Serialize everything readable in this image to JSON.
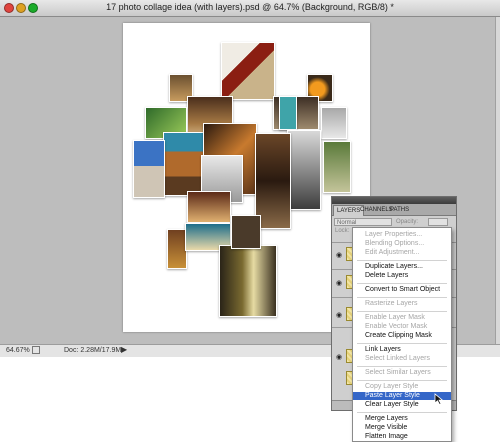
{
  "window": {
    "title": "17 photo collage idea (with layers).psd @ 64.7% (Background, RGB/8) *"
  },
  "statusbar": {
    "zoom": "64.67%",
    "doc_info": "Doc: 2.28M/17.9M"
  },
  "layers_panel": {
    "tabs": [
      "LAYERS",
      "CHANNELS",
      "PATHS"
    ],
    "blend_mode": "Normal",
    "opacity_label": "Opacity:",
    "lock_label": "Lock:"
  },
  "context_menu": {
    "items": [
      {
        "label": "Layer Properties...",
        "enabled": false
      },
      {
        "label": "Blending Options...",
        "enabled": false
      },
      {
        "label": "Edit Adjustment...",
        "enabled": false
      },
      {
        "label": "Duplicate Layers...",
        "enabled": true
      },
      {
        "label": "Delete Layers",
        "enabled": true
      },
      {
        "label": "Convert to Smart Object",
        "enabled": true
      },
      {
        "label": "Rasterize Layers",
        "enabled": false
      },
      {
        "label": "Enable Layer Mask",
        "enabled": false
      },
      {
        "label": "Enable Vector Mask",
        "enabled": false
      },
      {
        "label": "Create Clipping Mask",
        "enabled": true
      },
      {
        "label": "Link Layers",
        "enabled": true
      },
      {
        "label": "Select Linked Layers",
        "enabled": false
      },
      {
        "label": "Select Similar Layers",
        "enabled": false
      },
      {
        "label": "Copy Layer Style",
        "enabled": false
      },
      {
        "label": "Paste Layer Style",
        "enabled": true,
        "highlighted": true
      },
      {
        "label": "Clear Layer Style",
        "enabled": true
      },
      {
        "label": "Merge Layers",
        "enabled": true
      },
      {
        "label": "Merge Visible",
        "enabled": true
      },
      {
        "label": "Flatten Image",
        "enabled": true
      }
    ]
  },
  "colors": {
    "accent": "#3466c8",
    "workspace": "#bdbdbd"
  },
  "icons": {
    "cursor": "arrow-pointer-icon",
    "visibility": "eye-icon"
  }
}
